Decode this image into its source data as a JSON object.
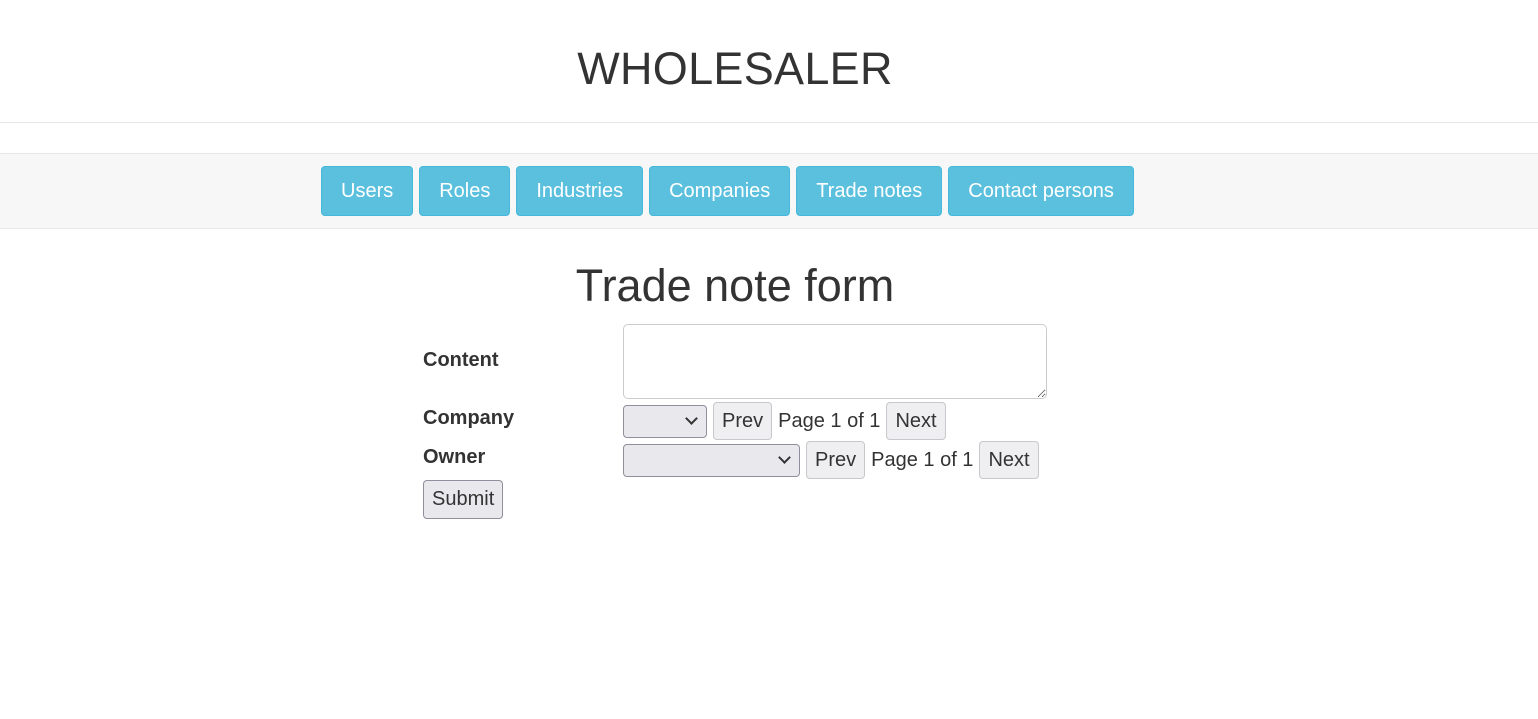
{
  "header": {
    "title": "WHOLESALER"
  },
  "nav": {
    "items": [
      {
        "label": "Users"
      },
      {
        "label": "Roles"
      },
      {
        "label": "Industries"
      },
      {
        "label": "Companies"
      },
      {
        "label": "Trade notes"
      },
      {
        "label": "Contact persons"
      }
    ]
  },
  "main": {
    "heading": "Trade note form",
    "content": {
      "label": "Content",
      "value": ""
    },
    "company": {
      "label": "Company",
      "selected": "",
      "prev_label": "Prev",
      "page_info": "Page 1 of 1",
      "next_label": "Next"
    },
    "owner": {
      "label": "Owner",
      "selected": "",
      "prev_label": "Prev",
      "page_info": "Page 1 of 1",
      "next_label": "Next"
    },
    "submit_label": "Submit"
  },
  "colors": {
    "nav_button": "#5bc0de",
    "nav_border": "#46b8da",
    "navbar_bg": "#f7f7f7",
    "text": "#333333"
  }
}
